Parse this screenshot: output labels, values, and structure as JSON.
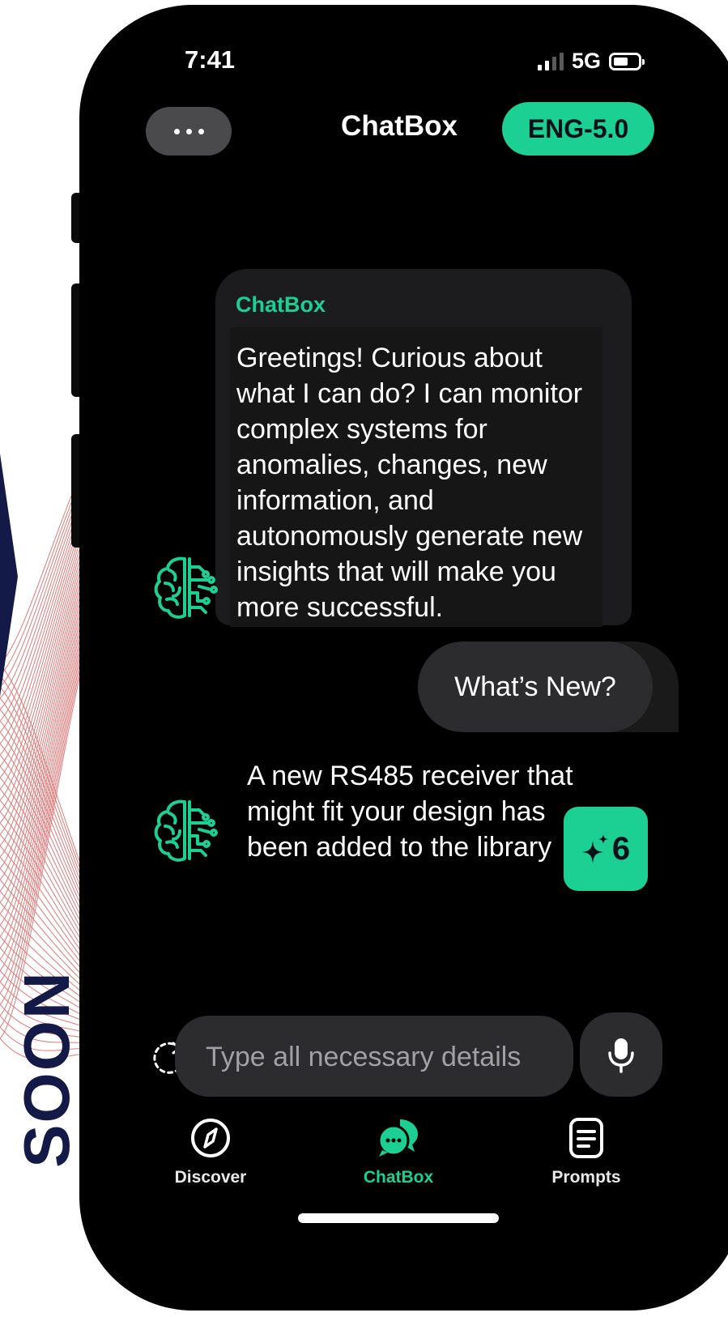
{
  "background": {
    "side_text": "SOON",
    "accent_line_color": "#e07a7a",
    "navy_color": "#131a47"
  },
  "status_bar": {
    "time": "7:41",
    "network": "5G",
    "battery_icon": "battery-icon",
    "signal_icon": "signal-icon"
  },
  "header": {
    "menu_icon": "more-horizontal-icon",
    "title": "ChatBox",
    "model_badge": "ENG-5.0"
  },
  "colors": {
    "accent": "#1ccf93",
    "screen_bg": "#000000",
    "bubble_bg": "#2c2c2e"
  },
  "messages": [
    {
      "sender": "ChatBox",
      "avatar_icon": "brain-circuit-icon",
      "text": "Greetings! Curious about what I can do? I can monitor complex systems for anomalies, changes, new information, and autonomously generate new insights that will make you more successful."
    },
    {
      "sender": "user",
      "text": "What’s New?"
    },
    {
      "sender": "bot",
      "avatar_icon": "brain-circuit-icon",
      "text": "A new RS485 receiver that might fit your design has been added to the library",
      "badge_icon": "sparkle-icon",
      "badge_count": "6"
    }
  ],
  "composer": {
    "placeholder": "Type all necessary details",
    "value": "",
    "refresh_icon": "refresh-icon",
    "mic_icon": "microphone-icon"
  },
  "tab_bar": {
    "tabs": [
      {
        "label": "Discover",
        "icon": "compass-icon",
        "active": false
      },
      {
        "label": "ChatBox",
        "icon": "chat-bubbles-icon",
        "active": true
      },
      {
        "label": "Prompts",
        "icon": "document-icon",
        "active": false
      }
    ]
  }
}
